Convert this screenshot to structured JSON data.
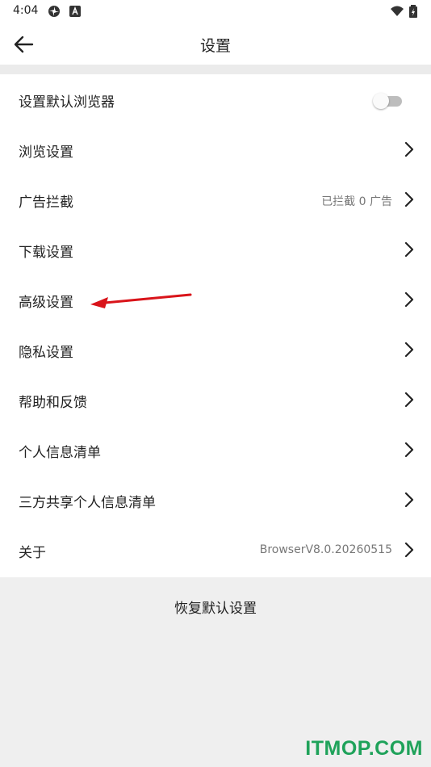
{
  "status_bar": {
    "time": "4:04",
    "icons": [
      "pinwheel-icon",
      "app-badge-icon",
      "wifi-icon",
      "battery-icon"
    ]
  },
  "app_bar": {
    "title": "设置",
    "back_icon": "arrow-left-icon"
  },
  "settings_rows": [
    {
      "label": "设置默认浏览器",
      "control": "toggle",
      "toggle_on": false
    },
    {
      "label": "浏览设置",
      "control": "chevron"
    },
    {
      "label": "广告拦截",
      "value": "已拦截 0 广告",
      "control": "chevron"
    },
    {
      "label": "下载设置",
      "control": "chevron"
    },
    {
      "label": "高级设置",
      "control": "chevron"
    },
    {
      "label": "隐私设置",
      "control": "chevron"
    },
    {
      "label": "帮助和反馈",
      "control": "chevron"
    },
    {
      "label": "个人信息清单",
      "control": "chevron"
    },
    {
      "label": "三方共享个人信息清单",
      "control": "chevron"
    },
    {
      "label": "关于",
      "value": "BrowserV8.0.20260515",
      "control": "chevron"
    }
  ],
  "reset_button": "恢复默认设置",
  "watermark": "ITMOP.COM",
  "colors": {
    "background": "#f0f0f0",
    "list_background": "#ffffff",
    "annotation_arrow": "#d9141a",
    "watermark": "#1fa25a"
  }
}
